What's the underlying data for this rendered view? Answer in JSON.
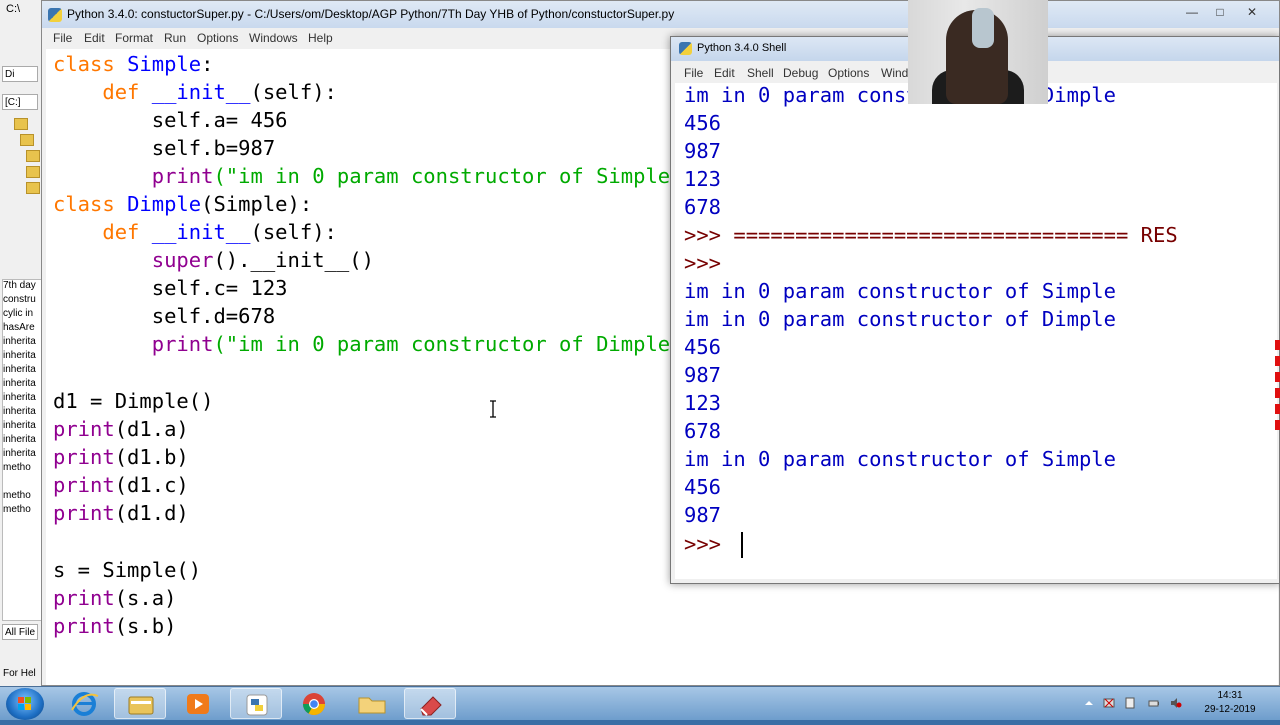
{
  "explorer": {
    "title": "C:\\",
    "address_short": "Di",
    "drive": "[C:]",
    "files": [
      "7th day",
      "constru",
      "cylic in",
      "hasAre",
      "inherita",
      "inherita",
      "inherita",
      "inherita",
      "inherita",
      "inherita",
      "inherita",
      "inherita",
      "inherita",
      "metho",
      "metho",
      "metho"
    ],
    "filter_label": "All File",
    "help_text": "For Hel"
  },
  "editor": {
    "title": "Python 3.4.0: constuctorSuper.py - C:/Users/om/Desktop/AGP Python/7Th Day YHB of Python/constuctorSuper.py",
    "menu": [
      "File",
      "Edit",
      "Format",
      "Run",
      "Options",
      "Windows",
      "Help"
    ],
    "code": {
      "l1_kw": "class",
      "l1_name": "Simple",
      "l1_rest": ":",
      "l2_kw": "def",
      "l2_name": "__init__",
      "l2_rest": "(self):",
      "l3": "self.a= 456",
      "l4": "self.b=987",
      "l5_bi": "print",
      "l5_str": "(\"im in 0 param constructor of Simple\")",
      "l6_kw": "class",
      "l6_name": "Dimple",
      "l6_rest": "(Simple):",
      "l7_kw": "def",
      "l7_name": "__init__",
      "l7_rest": "(self):",
      "l8_bi": "super",
      "l8_rest": "().__init__()",
      "l9": "self.c= 123",
      "l10": "self.d=678",
      "l11_bi": "print",
      "l11_str": "(\"im in 0 param constructor of Dimple\")",
      "l13": "d1 = Dimple()",
      "l14_bi": "print",
      "l14_rest": "(d1.a)",
      "l15_bi": "print",
      "l15_rest": "(d1.b)",
      "l16_bi": "print",
      "l16_rest": "(d1.c)",
      "l17_bi": "print",
      "l17_rest": "(d1.d)",
      "l19": "s = Simple()",
      "l20_bi": "print",
      "l20_rest": "(s.a)",
      "l21_bi": "print",
      "l21_rest": "(s.b)"
    }
  },
  "shell": {
    "title": "Python 3.4.0 Shell",
    "menu": [
      "File",
      "Edit",
      "Shell",
      "Debug",
      "Options",
      "Windo"
    ],
    "lines": [
      "im in 0 param constructor of Dimple",
      "456",
      "987",
      "123",
      "678"
    ],
    "restart_prompt": ">>>",
    "restart_line": " ================================ RES",
    "prompt2": ">>>",
    "lines2": [
      "im in 0 param constructor of Simple",
      "im in 0 param constructor of Dimple",
      "456",
      "987",
      "123",
      "678",
      "im in 0 param constructor of Simple",
      "456",
      "987"
    ],
    "final_prompt": ">>>"
  },
  "taskbar": {
    "apps": [
      "start",
      "internet-explorer",
      "file-explorer",
      "media-player",
      "python-idle",
      "chrome",
      "folder",
      "eraser-tool"
    ],
    "clock_time": "14:31",
    "clock_date": "29-12-2019"
  }
}
